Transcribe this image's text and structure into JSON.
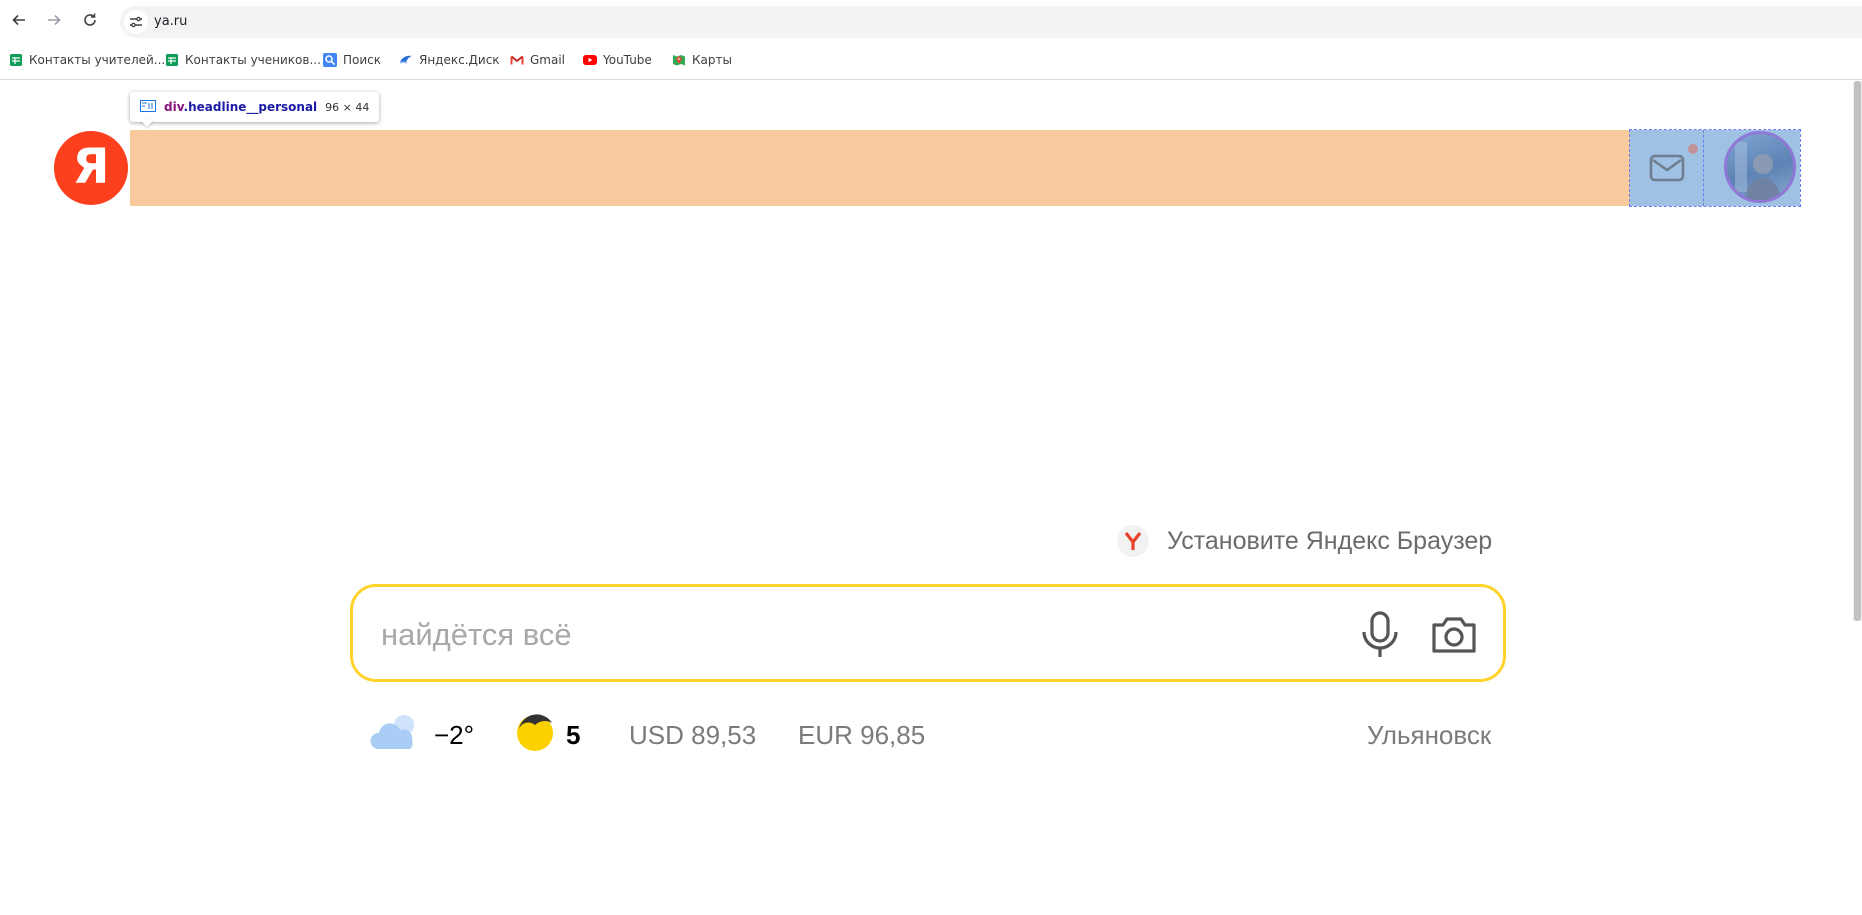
{
  "browser": {
    "url": "ya.ru",
    "nav": {
      "back": "back-arrow-icon",
      "forward": "forward-arrow-icon",
      "reload": "reload-icon"
    },
    "bookmarks": [
      {
        "label": "Контакты учителей...",
        "icon": "sheets-icon"
      },
      {
        "label": "Контакты учеников...",
        "icon": "sheets-icon"
      },
      {
        "label": "Поиск",
        "icon": "search-icon"
      },
      {
        "label": "Яндекс.Диск",
        "icon": "disk-icon"
      },
      {
        "label": "Gmail",
        "icon": "gmail-icon"
      },
      {
        "label": "YouTube",
        "icon": "youtube-icon"
      },
      {
        "label": "Карты",
        "icon": "maps-icon"
      }
    ]
  },
  "devtools_tooltip": {
    "selector_tag": "div",
    "selector_class": ".headline__personal",
    "dimensions": "96 × 44"
  },
  "header": {
    "logo_letter": "Я",
    "accent_color": "#fc3f1d",
    "highlight_color": "#f8cb9e",
    "personal_highlight_color": "#9fc1e3"
  },
  "promo": {
    "label": "Установите Яндекс Браузер"
  },
  "search": {
    "placeholder": "найдётся всё",
    "value": "",
    "border_color": "#fed42b"
  },
  "informers": {
    "weather": {
      "temp": "−2°",
      "icon": "cloud-icon"
    },
    "traffic": {
      "value": "5",
      "icon": "traffic-icon"
    },
    "usd": "USD 89,53",
    "eur": "EUR 96,85",
    "city": "Ульяновск"
  }
}
